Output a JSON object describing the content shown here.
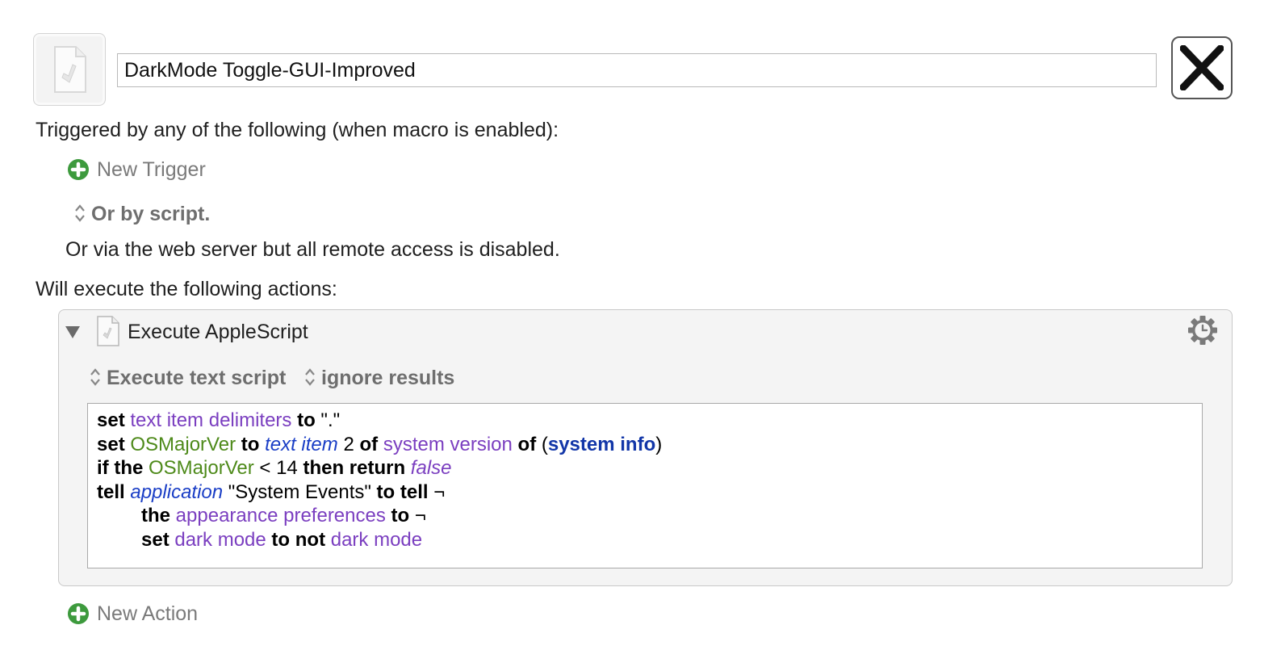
{
  "macro": {
    "title": "DarkMode Toggle-GUI-Improved"
  },
  "triggers": {
    "heading": "Triggered by any of the following (when macro is enabled):",
    "new_trigger": "New Trigger",
    "or_by_script": "Or by script.",
    "web_server": "Or via the web server but all remote access is disabled."
  },
  "actions": {
    "heading": "Will execute the following actions:",
    "new_action": "New Action",
    "items": [
      {
        "title": "Execute AppleScript",
        "mode": "Execute text script",
        "result_handling": "ignore results",
        "script": {
          "line1": {
            "a": "set",
            "b": "text item delimiters",
            "c": "to",
            "d": "\".\""
          },
          "line2": {
            "a": "set",
            "b": "OSMajorVer",
            "c": "to",
            "d": "text item",
            "e": "2",
            "f": "of",
            "g": "system version",
            "h": "of",
            "i": "(",
            "j": "system info",
            "k": ")"
          },
          "line3": {
            "a": "if the",
            "b": "OSMajorVer",
            "c": "< 14",
            "d": "then return",
            "e": "false"
          },
          "line4": {
            "a": "tell",
            "b": "application",
            "c": "\"System Events\"",
            "d": "to tell",
            "e": "¬"
          },
          "line5": {
            "a": "the",
            "b": "appearance preferences",
            "c": "to",
            "d": "¬"
          },
          "line6": {
            "a": "set",
            "b": "dark mode",
            "c": "to not",
            "d": "dark mode"
          }
        }
      }
    ]
  },
  "colors": {
    "plus_green": "#3d9a3d",
    "keyword": "#000000",
    "property": "#7b3fc0",
    "variable": "#4e8a1a",
    "class": "#1a3ec6"
  },
  "icons": {
    "macro": "script-document-icon",
    "close": "close-x-icon",
    "add": "plus-circle-icon",
    "stepper": "up-down-stepper-icon",
    "disclosure": "disclosure-triangle-icon",
    "gear": "gear-icon"
  }
}
